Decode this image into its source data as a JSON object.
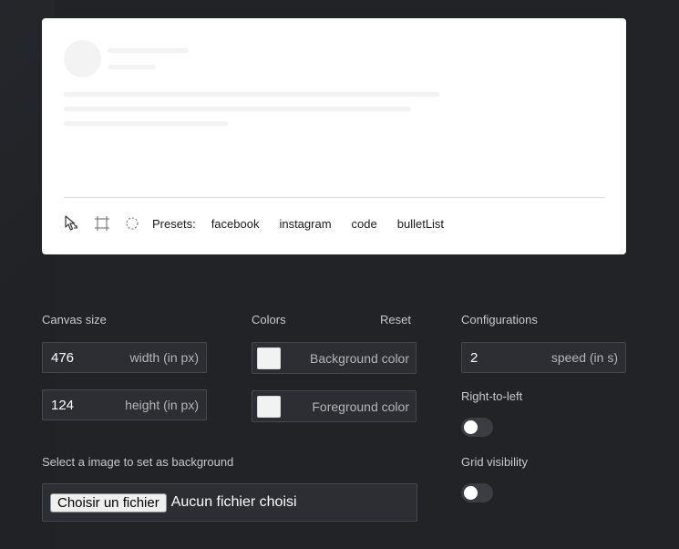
{
  "preview": {
    "toolbar": {
      "presets_label": "Presets:",
      "presets": [
        "facebook",
        "instagram",
        "code",
        "bulletList"
      ]
    }
  },
  "canvas": {
    "label": "Canvas size",
    "width_value": "476",
    "width_unit": "width (in px)",
    "height_value": "124",
    "height_unit": "height (in px)"
  },
  "colors": {
    "label": "Colors",
    "reset_label": "Reset",
    "background_label": "Background color",
    "background_value": "#f2f2f2",
    "foreground_label": "Foreground color",
    "foreground_value": "#f2f2f2"
  },
  "configurations": {
    "label": "Configurations",
    "speed_value": "2",
    "speed_unit": "speed (in s)",
    "rtl_label": "Right-to-left",
    "rtl_on": false,
    "grid_label": "Grid visibility",
    "grid_on": false
  },
  "background_image": {
    "label": "Select a image to set as background",
    "button_label": "Choisir un fichier",
    "status_text": "Aucun fichier choisi"
  }
}
